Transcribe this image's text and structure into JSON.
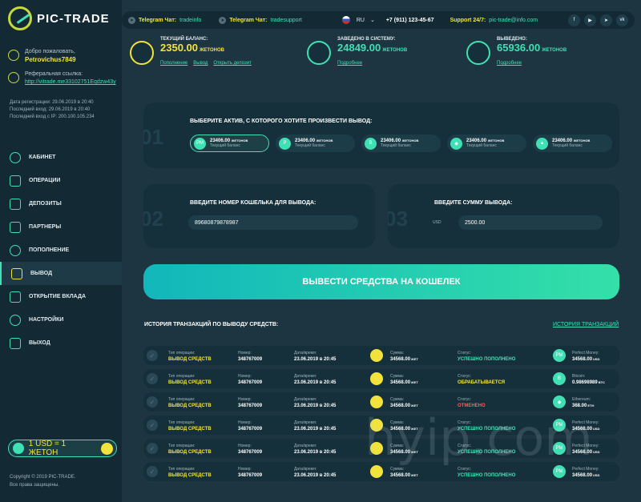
{
  "brand": {
    "name": "PIC-TRADE"
  },
  "user": {
    "welcome": "Добро пожаловать,",
    "name": "Petrovichus7849",
    "ref_label": "Реферальная ссылка:",
    "ref_link": "http://vitrade.me33102751Eqdzw43y",
    "reg": "Дата регистрации: 29.06.2019 в 20:40",
    "last_login": "Последний вход: 29.06.2019 в 20:40",
    "last_ip": "Последний вход с IP: 200.100.105.234"
  },
  "nav": [
    {
      "label": "КАБИНЕТ"
    },
    {
      "label": "ОПЕРАЦИИ"
    },
    {
      "label": "ДЕПОЗИТЫ"
    },
    {
      "label": "ПАРТНЕРЫ"
    },
    {
      "label": "ПОПОЛНЕНИЕ"
    },
    {
      "label": "ВЫВОД"
    },
    {
      "label": "ОТКРЫТИЕ ВКЛАДА"
    },
    {
      "label": "НАСТРОЙКИ"
    },
    {
      "label": "ВЫХОД"
    }
  ],
  "rate": "1 USD = 1 ЖЕТОН",
  "copyright": [
    "Copyright © 2019 PIC-TRADE.",
    "Все права защищены."
  ],
  "topbar": {
    "tg1_label": "Telegram Чат:",
    "tg1_link": "tradeinfo",
    "tg2_label": "Telegram Чат:",
    "tg2_link": "tradesupport",
    "lang": "RU",
    "phone": "+7 (911) 123-45-67",
    "support_label": "Support 24/7:",
    "support_email": "pic-trade@info.com",
    "socials": [
      "f",
      "▶",
      "➤",
      "vk"
    ]
  },
  "stats": [
    {
      "label": "ТЕКУЩИЙ БАЛАНС:",
      "value": "2350.00",
      "unit": "ЖЕТОНОВ",
      "color": "#f2e33c",
      "links": [
        "Пополнение",
        "Вывод",
        "Открыть депозит"
      ]
    },
    {
      "label": "ЗАВЕДЕНО В СИСТЕМУ:",
      "value": "24849.00",
      "unit": "ЖЕТОНОВ",
      "color": "#3fe0b4",
      "links": [
        "Подробнее"
      ]
    },
    {
      "label": "ВЫВЕДЕНО:",
      "value": "65936.00",
      "unit": "ЖЕТОНОВ",
      "color": "#3fe0b4",
      "links": [
        "Подробнее"
      ]
    }
  ],
  "step1": {
    "num": "01",
    "title": "ВЫБЕРИТЕ АКТИВ, С КОТОРОГО ХОТИТЕ ПРОИЗВЕСТИ ВЫВОД:",
    "assets": [
      {
        "icon": "PM",
        "value": "23406.00",
        "unit": "ЖЕТОНОВ",
        "sub": "Текущий баланс"
      },
      {
        "icon": "P",
        "value": "23406.00",
        "unit": "ЖЕТОНОВ",
        "sub": "Текущий баланс"
      },
      {
        "icon": "B",
        "value": "23406.00",
        "unit": "ЖЕТОНОВ",
        "sub": "Текущий баланс"
      },
      {
        "icon": "◆",
        "value": "23406.00",
        "unit": "ЖЕТОНОВ",
        "sub": "Текущий баланс"
      },
      {
        "icon": "▲",
        "value": "23406.00",
        "unit": "ЖЕТОНОВ",
        "sub": "Текущий баланс"
      }
    ]
  },
  "step2": {
    "num": "02",
    "title": "ВВЕДИТЕ НОМЕР КОШЕЛЬКА ДЛЯ ВЫВОДА:",
    "value": "89680879878987"
  },
  "step3": {
    "num": "03",
    "title": "ВВЕДИТЕ СУММУ ВЫВОДА:",
    "currency": "USD",
    "value": "2500.00"
  },
  "cta": "ВЫВЕСТИ СРЕДСТВА НА КОШЕЛЕК",
  "history": {
    "title": "ИСТОРИЯ ТРАНЗАКЦИЙ ПО ВЫВОДУ СРЕДСТВ:",
    "link": "ИСТОРИЯ ТРАНЗАКЦИЙ",
    "labels": {
      "type": "Тип операции:",
      "number": "Номер:",
      "date": "Дата/время:",
      "sum": "Сумма:",
      "status": "Статус:"
    },
    "rows": [
      {
        "type": "ВЫВОД СРЕДСТВ",
        "number": "348767009",
        "date": "23.06.2019 в 20:45",
        "sum": "34568.00",
        "sum_unit": "ЖЕТ",
        "status": "УСПЕШНО ПОПОЛНЕНО",
        "status_kind": "g",
        "sys": "Perfect Money:",
        "sys_icon": "PM",
        "amount": "34568.00",
        "amount_unit": "USD"
      },
      {
        "type": "ВЫВОД СРЕДСТВ",
        "number": "348767009",
        "date": "23.06.2019 в 20:45",
        "sum": "34568.00",
        "sum_unit": "ЖЕТ",
        "status": "ОБРАБАТЫВАЕТСЯ",
        "status_kind": "o",
        "sys": "Bitcoin:",
        "sys_icon": "B",
        "amount": "0.98698989",
        "amount_unit": "BTC"
      },
      {
        "type": "ВЫВОД СРЕДСТВ",
        "number": "348767009",
        "date": "23.06.2019 в 20:45",
        "sum": "34568.00",
        "sum_unit": "ЖЕТ",
        "status": "ОТМЕНЕНО",
        "status_kind": "r",
        "sys": "Ethereum:",
        "sys_icon": "◆",
        "amount": "368.00",
        "amount_unit": "ETH"
      },
      {
        "type": "ВЫВОД СРЕДСТВ",
        "number": "348767009",
        "date": "23.06.2019 в 20:45",
        "sum": "34568.00",
        "sum_unit": "ЖЕТ",
        "status": "УСПЕШНО ПОПОЛНЕНО",
        "status_kind": "g",
        "sys": "Perfect Money:",
        "sys_icon": "PM",
        "amount": "34568.00",
        "amount_unit": "USD"
      },
      {
        "type": "ВЫВОД СРЕДСТВ",
        "number": "348767009",
        "date": "23.06.2019 в 20:45",
        "sum": "34568.00",
        "sum_unit": "ЖЕТ",
        "status": "УСПЕШНО ПОПОЛНЕНО",
        "status_kind": "g",
        "sys": "Perfect Money:",
        "sys_icon": "PM",
        "amount": "34568.00",
        "amount_unit": "USD"
      },
      {
        "type": "ВЫВОД СРЕДСТВ",
        "number": "348767009",
        "date": "23.06.2019 в 20:45",
        "sum": "34568.00",
        "sum_unit": "ЖЕТ",
        "status": "УСПЕШНО ПОПОЛНЕНО",
        "status_kind": "g",
        "sys": "Perfect Money:",
        "sys_icon": "PM",
        "amount": "34568.00",
        "amount_unit": "USD"
      }
    ]
  },
  "watermark": "hyip.com"
}
